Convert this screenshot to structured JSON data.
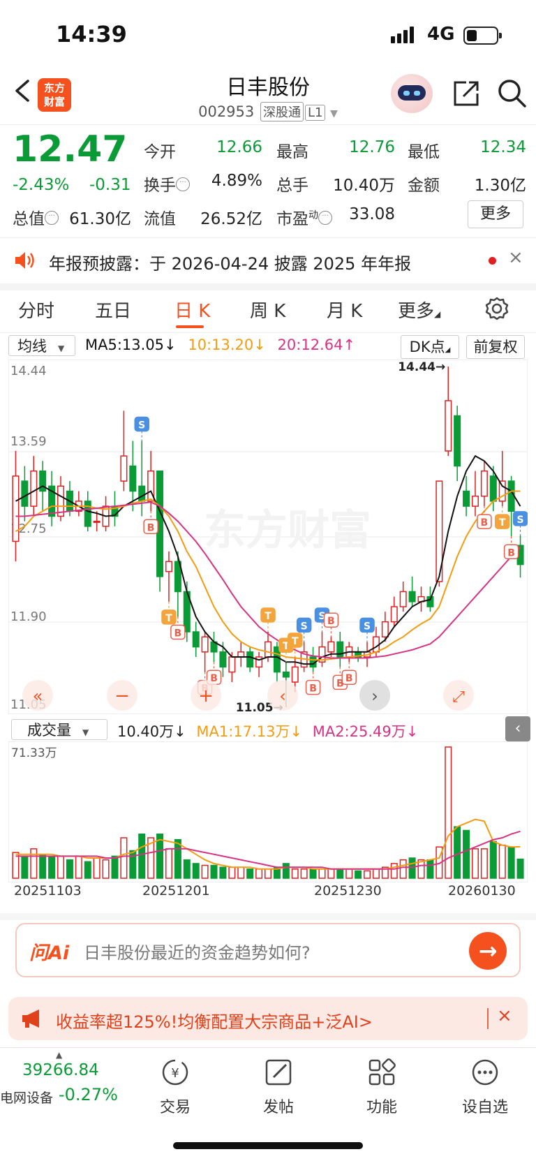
{
  "status_bar": {
    "time": "14:39",
    "network": "4G"
  },
  "header": {
    "logo_line1": "东方",
    "logo_line2": "财富",
    "stock_name": "日丰股份",
    "stock_code": "002953",
    "tag_market": "深股通",
    "tag_level": "L1"
  },
  "quote": {
    "price": "12.47",
    "change_pct": "-2.43%",
    "change_abs": "-0.31",
    "labels": {
      "open": "今开",
      "high": "最高",
      "low": "最低",
      "turnover": "换手",
      "volume": "总手",
      "amount": "金额",
      "mktcap": "总值",
      "float_cap": "流值",
      "pe": "市盈",
      "pe_sup": "动"
    },
    "values": {
      "open": "12.66",
      "high": "12.76",
      "low": "12.34",
      "turnover": "4.89%",
      "volume": "10.40万",
      "amount": "1.30亿",
      "mktcap": "61.30亿",
      "float_cap": "26.52亿",
      "pe": "33.08"
    },
    "more_label": "更多"
  },
  "notice": {
    "text": "年报预披露：于 2026-04-24 披露 2025 年年报",
    "close": "×"
  },
  "tabs": [
    "分时",
    "五日",
    "日 K",
    "周 K",
    "月 K",
    "更多"
  ],
  "active_tab": "日 K",
  "ma_bar": {
    "select": "均线",
    "ma5": "MA5:13.05↓",
    "ma10": "10:13.20↓",
    "ma20": "20:12.64↑",
    "dk": "DK点",
    "adjust": "前复权"
  },
  "kline": {
    "y_labels": [
      "14.44",
      "13.59",
      "12.75",
      "11.90",
      "11.05"
    ],
    "watermark": "东方财富",
    "max_label": "14.44→",
    "min_label": "11.05→"
  },
  "volume_bar": {
    "select": "成交量",
    "vol": "10.40万↓",
    "ma1": "MA1:17.13万↓",
    "ma2": "MA2:25.49万↓",
    "max_label": "71.33万"
  },
  "date_labels": [
    "20251103",
    "20251201",
    "20251230",
    "20260130"
  ],
  "ai": {
    "logo": "问Ai",
    "question": "日丰股份最近的资金趋势如何?",
    "go": "→"
  },
  "ad": {
    "text": "收益率超125%!均衡配置大宗商品+泛AI>",
    "close": "×"
  },
  "bottom_nav": {
    "index_value": "39266.84",
    "index_name": "电网设备",
    "index_change": "-0.27%",
    "items": [
      "交易",
      "发帖",
      "功能",
      "设自选"
    ]
  },
  "colors": {
    "up": "#e02020",
    "down": "#0a9a36",
    "accent": "#f4511e",
    "ma5": "#111111",
    "ma10": "#f39c12",
    "ma20": "#d63384"
  },
  "chart_data": {
    "type": "candlestick",
    "ylim": [
      11.05,
      14.44
    ],
    "candles": [
      {
        "o": 12.7,
        "c": 13.35,
        "h": 13.6,
        "l": 12.5
      },
      {
        "o": 13.3,
        "c": 13.05,
        "h": 13.45,
        "l": 12.9
      },
      {
        "o": 13.05,
        "c": 13.4,
        "h": 13.55,
        "l": 12.95
      },
      {
        "o": 13.4,
        "c": 13.2,
        "h": 13.5,
        "l": 13.0
      },
      {
        "o": 13.25,
        "c": 12.95,
        "h": 13.4,
        "l": 12.85
      },
      {
        "o": 12.95,
        "c": 13.25,
        "h": 13.35,
        "l": 12.9
      },
      {
        "o": 13.2,
        "c": 13.0,
        "h": 13.3,
        "l": 12.95
      },
      {
        "o": 13.0,
        "c": 13.1,
        "h": 13.2,
        "l": 12.95
      },
      {
        "o": 13.1,
        "c": 12.85,
        "h": 13.2,
        "l": 12.8
      },
      {
        "o": 12.9,
        "c": 12.9,
        "h": 13.0,
        "l": 12.8
      },
      {
        "o": 12.85,
        "c": 13.05,
        "h": 13.15,
        "l": 12.8
      },
      {
        "o": 13.05,
        "c": 12.95,
        "h": 13.2,
        "l": 12.85
      },
      {
        "o": 13.3,
        "c": 13.55,
        "h": 14.0,
        "l": 13.2
      },
      {
        "o": 13.45,
        "c": 13.2,
        "h": 13.7,
        "l": 13.0
      },
      {
        "o": 13.25,
        "c": 13.1,
        "h": 13.7,
        "l": 12.95
      },
      {
        "o": 13.1,
        "c": 13.4,
        "h": 13.6,
        "l": 13.0
      },
      {
        "o": 13.4,
        "c": 12.35,
        "h": 13.4,
        "l": 12.2
      },
      {
        "o": 12.4,
        "c": 12.5,
        "h": 12.6,
        "l": 12.1
      },
      {
        "o": 12.5,
        "c": 12.2,
        "h": 12.6,
        "l": 11.95
      },
      {
        "o": 12.2,
        "c": 11.8,
        "h": 12.3,
        "l": 11.7
      },
      {
        "o": 11.8,
        "c": 11.65,
        "h": 11.9,
        "l": 11.55
      },
      {
        "o": 11.6,
        "c": 11.75,
        "h": 11.8,
        "l": 11.4
      },
      {
        "o": 11.7,
        "c": 11.6,
        "h": 11.8,
        "l": 11.5
      },
      {
        "o": 11.6,
        "c": 11.45,
        "h": 11.7,
        "l": 11.35
      },
      {
        "o": 11.4,
        "c": 11.55,
        "h": 11.6,
        "l": 11.3
      },
      {
        "o": 11.55,
        "c": 11.6,
        "h": 11.7,
        "l": 11.45
      },
      {
        "o": 11.6,
        "c": 11.45,
        "h": 11.65,
        "l": 11.4
      },
      {
        "o": 11.45,
        "c": 11.55,
        "h": 11.6,
        "l": 11.35
      },
      {
        "o": 11.55,
        "c": 11.7,
        "h": 11.8,
        "l": 11.5
      },
      {
        "o": 11.65,
        "c": 11.4,
        "h": 11.7,
        "l": 11.3
      },
      {
        "o": 11.4,
        "c": 11.35,
        "h": 11.5,
        "l": 11.05
      },
      {
        "o": 11.3,
        "c": 11.45,
        "h": 11.55,
        "l": 11.2
      },
      {
        "o": 11.45,
        "c": 11.6,
        "h": 11.7,
        "l": 11.4
      },
      {
        "o": 11.55,
        "c": 11.45,
        "h": 11.65,
        "l": 11.4
      },
      {
        "o": 11.5,
        "c": 11.65,
        "h": 11.8,
        "l": 11.45
      },
      {
        "o": 11.6,
        "c": 11.7,
        "h": 11.75,
        "l": 11.55
      },
      {
        "o": 11.7,
        "c": 11.55,
        "h": 11.8,
        "l": 11.45
      },
      {
        "o": 11.55,
        "c": 11.65,
        "h": 11.7,
        "l": 11.5
      },
      {
        "o": 11.6,
        "c": 11.55,
        "h": 11.65,
        "l": 11.5
      },
      {
        "o": 11.55,
        "c": 11.6,
        "h": 11.7,
        "l": 11.45
      },
      {
        "o": 11.6,
        "c": 11.75,
        "h": 11.85,
        "l": 11.55
      },
      {
        "o": 11.75,
        "c": 11.9,
        "h": 12.0,
        "l": 11.7
      },
      {
        "o": 11.9,
        "c": 12.05,
        "h": 12.15,
        "l": 11.85
      },
      {
        "o": 12.05,
        "c": 12.2,
        "h": 12.3,
        "l": 12.0
      },
      {
        "o": 12.2,
        "c": 12.1,
        "h": 12.35,
        "l": 12.05
      },
      {
        "o": 12.1,
        "c": 12.15,
        "h": 12.25,
        "l": 12.0
      },
      {
        "o": 12.15,
        "c": 12.05,
        "h": 12.25,
        "l": 12.0
      },
      {
        "o": 12.3,
        "c": 13.3,
        "h": 13.3,
        "l": 12.25
      },
      {
        "o": 13.6,
        "c": 14.1,
        "h": 14.44,
        "l": 13.55
      },
      {
        "o": 13.95,
        "c": 13.45,
        "h": 14.05,
        "l": 13.3
      },
      {
        "o": 13.2,
        "c": 13.05,
        "h": 13.35,
        "l": 12.95
      },
      {
        "o": 13.05,
        "c": 13.15,
        "h": 13.4,
        "l": 12.95
      },
      {
        "o": 13.15,
        "c": 13.4,
        "h": 13.5,
        "l": 13.05
      },
      {
        "o": 13.35,
        "c": 13.1,
        "h": 13.45,
        "l": 13.0
      },
      {
        "o": 13.1,
        "c": 13.3,
        "h": 13.6,
        "l": 13.05
      },
      {
        "o": 13.3,
        "c": 13.0,
        "h": 13.35,
        "l": 12.75
      },
      {
        "o": 12.66,
        "c": 12.47,
        "h": 12.76,
        "l": 12.34
      }
    ],
    "ma5": [
      13.1,
      13.15,
      13.2,
      13.25,
      13.2,
      13.15,
      13.1,
      13.05,
      13.0,
      12.98,
      12.95,
      12.96,
      13.05,
      13.1,
      13.15,
      13.2,
      13.0,
      12.8,
      12.55,
      12.2,
      11.95,
      11.8,
      11.7,
      11.65,
      11.55,
      11.55,
      11.55,
      11.52,
      11.55,
      11.55,
      11.5,
      11.5,
      11.48,
      11.48,
      11.55,
      11.58,
      11.58,
      11.6,
      11.6,
      11.6,
      11.65,
      11.72,
      11.85,
      11.95,
      12.05,
      12.1,
      12.12,
      12.35,
      12.8,
      13.15,
      13.4,
      13.55,
      13.5,
      13.4,
      13.25,
      13.2,
      13.05
    ],
    "ma10": [
      12.8,
      12.85,
      12.95,
      13.0,
      13.05,
      13.05,
      13.05,
      13.05,
      13.05,
      13.03,
      13.02,
      13.03,
      13.05,
      13.08,
      13.1,
      13.12,
      13.05,
      12.95,
      12.8,
      12.6,
      12.45,
      12.25,
      12.05,
      11.9,
      11.78,
      11.7,
      11.65,
      11.62,
      11.6,
      11.58,
      11.55,
      11.54,
      11.53,
      11.52,
      11.52,
      11.53,
      11.54,
      11.55,
      11.56,
      11.57,
      11.6,
      11.64,
      11.7,
      11.75,
      11.82,
      11.88,
      11.93,
      12.05,
      12.3,
      12.55,
      12.75,
      12.9,
      13.0,
      13.1,
      13.15,
      13.2,
      13.2
    ],
    "ma20": [
      12.95,
      12.95,
      12.96,
      12.97,
      12.98,
      12.99,
      13.0,
      13.01,
      13.02,
      13.03,
      13.04,
      13.05,
      13.06,
      13.07,
      13.08,
      13.09,
      13.05,
      12.98,
      12.9,
      12.8,
      12.7,
      12.58,
      12.45,
      12.32,
      12.18,
      12.05,
      11.95,
      11.85,
      11.78,
      11.72,
      11.66,
      11.62,
      11.58,
      11.56,
      11.55,
      11.54,
      11.54,
      11.54,
      11.54,
      11.54,
      11.55,
      11.56,
      11.58,
      11.6,
      11.62,
      11.65,
      11.68,
      11.75,
      11.85,
      11.95,
      12.05,
      12.15,
      12.25,
      12.35,
      12.45,
      12.55,
      12.64
    ],
    "signals": [
      {
        "i": 14,
        "label": "S",
        "type": "S",
        "above": true
      },
      {
        "i": 15,
        "label": "B",
        "type": "B",
        "above": false
      },
      {
        "i": 17,
        "label": "T",
        "type": "T",
        "above": false
      },
      {
        "i": 18,
        "label": "B",
        "type": "B",
        "above": false
      },
      {
        "i": 21,
        "label": "B",
        "type": "B",
        "above": false
      },
      {
        "i": 22,
        "label": "B",
        "type": "B",
        "above": false
      },
      {
        "i": 28,
        "label": "T",
        "type": "T",
        "above": true
      },
      {
        "i": 30,
        "label": "T",
        "type": "T",
        "above": true
      },
      {
        "i": 31,
        "label": "T",
        "type": "T",
        "above": true
      },
      {
        "i": 32,
        "label": "S",
        "type": "S",
        "above": true
      },
      {
        "i": 34,
        "label": "S",
        "type": "S",
        "above": true
      },
      {
        "i": 35,
        "label": "B",
        "type": "B",
        "above": true
      },
      {
        "i": 33,
        "label": "B",
        "type": "B",
        "above": false
      },
      {
        "i": 36,
        "label": "B",
        "type": "B",
        "above": false
      },
      {
        "i": 37,
        "label": "B",
        "type": "B",
        "above": false
      },
      {
        "i": 39,
        "label": "S",
        "type": "S",
        "above": true
      },
      {
        "i": 52,
        "label": "B",
        "type": "B",
        "above": false
      },
      {
        "i": 54,
        "label": "T",
        "type": "T",
        "above": false
      },
      {
        "i": 55,
        "label": "B",
        "type": "B",
        "above": false
      },
      {
        "i": 56,
        "label": "S",
        "type": "S",
        "above": true
      }
    ],
    "volume": {
      "ylim": [
        0,
        71.33
      ],
      "values": [
        14,
        12,
        16,
        13,
        12,
        12,
        10,
        12,
        9,
        11,
        10,
        12,
        22,
        15,
        24,
        22,
        24,
        16,
        21,
        10,
        8,
        7,
        7,
        6,
        6,
        6,
        5,
        5,
        5,
        6,
        8,
        5,
        5,
        5,
        5,
        5,
        5,
        5,
        4,
        4,
        5,
        6,
        8,
        10,
        11,
        10,
        10,
        17,
        71.33,
        28,
        26,
        16,
        16,
        20,
        18,
        17,
        10.4
      ],
      "ma1": [
        13,
        13,
        13,
        13,
        13,
        12,
        12,
        12,
        11,
        11,
        11,
        11,
        13,
        14,
        17,
        19,
        21,
        20,
        19,
        16,
        13,
        10,
        8,
        7,
        6,
        6,
        6,
        5,
        5,
        5,
        6,
        6,
        6,
        5,
        5,
        5,
        5,
        5,
        5,
        5,
        5,
        5,
        6,
        7,
        8,
        9,
        10,
        11,
        23,
        28,
        30,
        32,
        31,
        20,
        18,
        17,
        17.13
      ],
      "ma2": [
        12,
        12,
        12,
        12,
        12,
        12,
        12,
        12,
        12,
        12,
        11,
        11,
        12,
        12,
        13,
        14,
        15,
        16,
        16,
        16,
        15,
        14,
        13,
        12,
        11,
        10,
        9,
        8,
        7,
        6,
        6,
        6,
        6,
        6,
        6,
        5,
        5,
        5,
        5,
        5,
        5,
        5,
        5,
        6,
        6,
        7,
        7,
        8,
        11,
        13,
        15,
        17,
        19,
        21,
        22,
        24,
        25.49
      ]
    }
  }
}
